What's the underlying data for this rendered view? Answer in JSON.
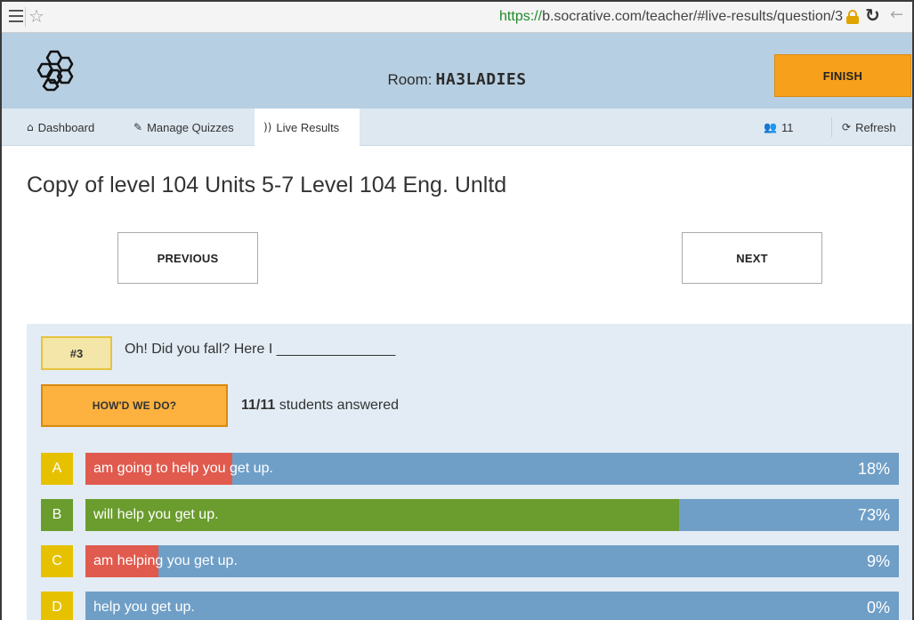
{
  "browser": {
    "url_scheme": "https://",
    "url_rest": "b.socrative.com/teacher/#live-results/question/3"
  },
  "header": {
    "room_label": "Room:",
    "room_code": "HA3LADIES",
    "finish_label": "FINISH"
  },
  "nav": {
    "dashboard": "Dashboard",
    "manage_quizzes": "Manage Quizzes",
    "live_results": "Live Results",
    "student_count": "11",
    "refresh": "Refresh"
  },
  "quiz_title": "Copy of level 104 Units 5-7 Level 104 Eng. Unltd",
  "buttons": {
    "previous": "PREVIOUS",
    "next": "NEXT"
  },
  "question": {
    "number": "#3",
    "text": "Oh! Did you fall? Here I _______________",
    "howd_label": "HOW'D WE DO?",
    "answered_count": "11/11",
    "answered_suffix": "students answered"
  },
  "answers": [
    {
      "letter": "A",
      "text": "am going to help you get up.",
      "percent_label": "18%",
      "percent": 18,
      "fill_color": "#e05a4e",
      "letter_color": "#e6c100"
    },
    {
      "letter": "B",
      "text": "will help you get up.",
      "percent_label": "73%",
      "percent": 73,
      "fill_color": "#6a9c2e",
      "letter_color": "#6a9c2e"
    },
    {
      "letter": "C",
      "text": "am helping you get up.",
      "percent_label": "9%",
      "percent": 9,
      "fill_color": "#e05a4e",
      "letter_color": "#e6c100"
    },
    {
      "letter": "D",
      "text": "help you get up.",
      "percent_label": "0%",
      "percent": 0,
      "fill_color": "#e05a4e",
      "letter_color": "#e6c100"
    }
  ],
  "colors": {
    "header_bg": "#b7cfe2",
    "nav_bg": "#dde8f1",
    "finish_bg": "#f7a01b",
    "bar_bg": "#6f9fc7"
  },
  "icons": [
    "menu-icon",
    "star-icon",
    "lock-icon",
    "reload-icon",
    "back-icon",
    "hive-logo-icon",
    "home-icon",
    "wrench-icon",
    "broadcast-icon",
    "users-icon",
    "refresh-icon"
  ]
}
